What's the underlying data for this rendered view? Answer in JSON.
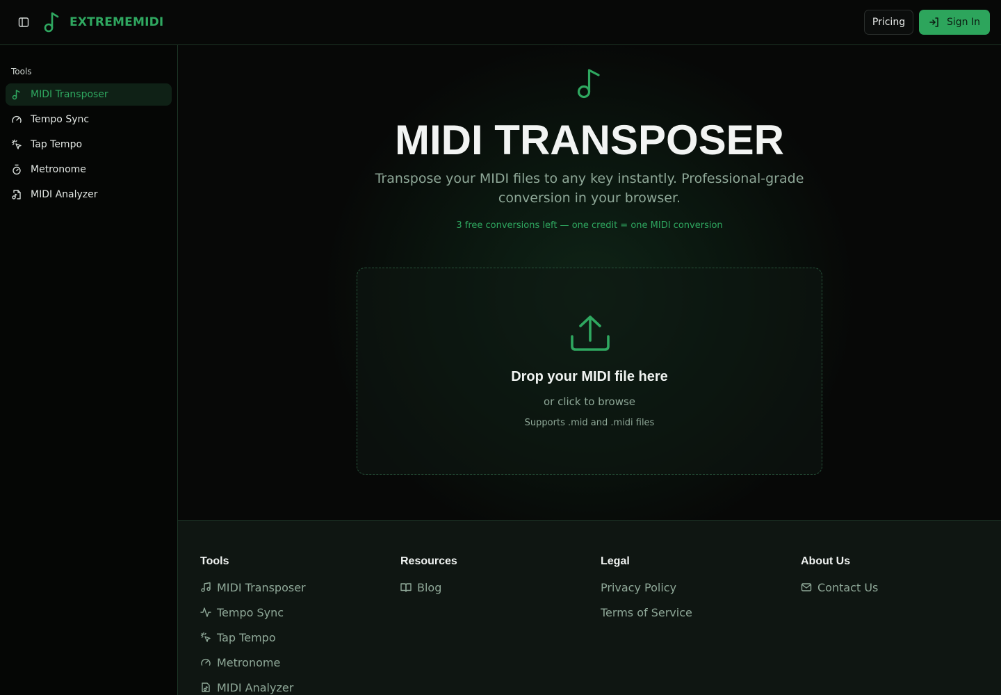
{
  "header": {
    "brand": "EXTREMEMIDI",
    "pricing_label": "Pricing",
    "signin_label": "Sign In"
  },
  "sidebar": {
    "heading": "Tools",
    "items": [
      {
        "label": "MIDI Transposer",
        "icon": "music-note-icon",
        "active": true
      },
      {
        "label": "Tempo Sync",
        "icon": "gauge-icon"
      },
      {
        "label": "Tap Tempo",
        "icon": "pointer-click-icon"
      },
      {
        "label": "Metronome",
        "icon": "timer-icon"
      },
      {
        "label": "MIDI Analyzer",
        "icon": "file-music-icon"
      }
    ]
  },
  "hero": {
    "title": "MIDI TRANSPOSER",
    "subtitle": "Transpose your MIDI files to any key instantly. Professional-grade conversion in your browser.",
    "credits": "3 free conversions left — one credit = one MIDI conversion"
  },
  "dropzone": {
    "title": "Drop your MIDI file here",
    "subtitle": "or click to browse",
    "note": "Supports .mid and .midi files"
  },
  "footer": {
    "tools": {
      "heading": "Tools",
      "links": [
        "MIDI Transposer",
        "Tempo Sync",
        "Tap Tempo",
        "Metronome",
        "MIDI Analyzer"
      ]
    },
    "resources": {
      "heading": "Resources",
      "links": [
        "Blog"
      ]
    },
    "legal": {
      "heading": "Legal",
      "links": [
        "Privacy Policy",
        "Terms of Service"
      ]
    },
    "about": {
      "heading": "About Us",
      "links": [
        "Contact Us"
      ]
    }
  },
  "colors": {
    "accent": "#2fa860",
    "accent_button": "#2da55c",
    "background": "#070807",
    "muted_text": "#8fa898",
    "border": "#1d3526"
  }
}
